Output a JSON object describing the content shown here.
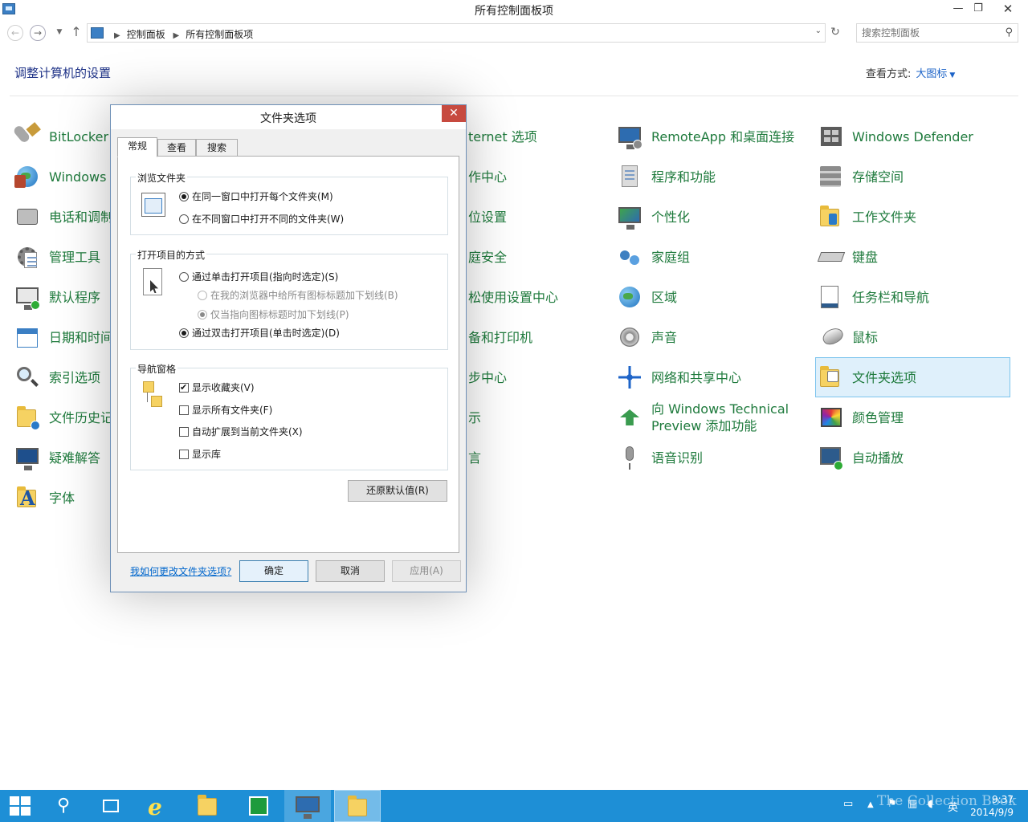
{
  "window": {
    "title": "所有控制面板项"
  },
  "address": {
    "crumbs": [
      "控制面板",
      "所有控制面板项"
    ],
    "search_placeholder": "搜索控制面板"
  },
  "header": {
    "heading": "调整计算机的设置",
    "viewby_label": "查看方式:",
    "viewby_value": "大图标"
  },
  "items": {
    "col1": [
      "BitLocker",
      "Windows",
      "电话和调制",
      "管理工具",
      "默认程序",
      "日期和时间",
      "索引选项",
      "文件历史记",
      "疑难解答",
      "字体"
    ],
    "col2": [
      "ternet 选项",
      "作中心",
      "位设置",
      "庭安全",
      "松使用设置中心",
      "备和打印机",
      "步中心",
      "示",
      "言"
    ],
    "col3": [
      "RemoteApp 和桌面连接",
      "程序和功能",
      "个性化",
      "家庭组",
      "区域",
      "声音",
      "网络和共享中心",
      "向 Windows Technical Preview 添加功能",
      "语音识别"
    ],
    "col4": [
      "Windows Defender",
      "存储空间",
      "工作文件夹",
      "键盘",
      "任务栏和导航",
      "鼠标",
      "文件夹选项",
      "颜色管理",
      "自动播放"
    ]
  },
  "dialog": {
    "title": "文件夹选项",
    "tabs": [
      "常规",
      "查看",
      "搜索"
    ],
    "browse": {
      "title": "浏览文件夹",
      "opt_same": "在同一窗口中打开每个文件夹(M)",
      "opt_new": "在不同窗口中打开不同的文件夹(W)"
    },
    "open": {
      "title": "打开项目的方式",
      "opt_single": "通过单击打开项目(指向时选定)(S)",
      "opt_underline_all": "在我的浏览器中给所有图标标题加下划线(B)",
      "opt_underline_hover": "仅当指向图标标题时加下划线(P)",
      "opt_double": "通过双击打开项目(单击时选定)(D)"
    },
    "nav": {
      "title": "导航窗格",
      "opt_favorites": "显示收藏夹(V)",
      "opt_all_folders": "显示所有文件夹(F)",
      "opt_expand": "自动扩展到当前文件夹(X)",
      "opt_libraries": "显示库"
    },
    "restore_button": "还原默认值(R)",
    "help_link": "我如何更改文件夹选项?",
    "ok": "确定",
    "cancel": "取消",
    "apply": "应用(A)"
  },
  "taskbar": {
    "ime": "英",
    "time": "9:37",
    "date": "2014/9/9"
  },
  "watermark": "The Collection Book"
}
